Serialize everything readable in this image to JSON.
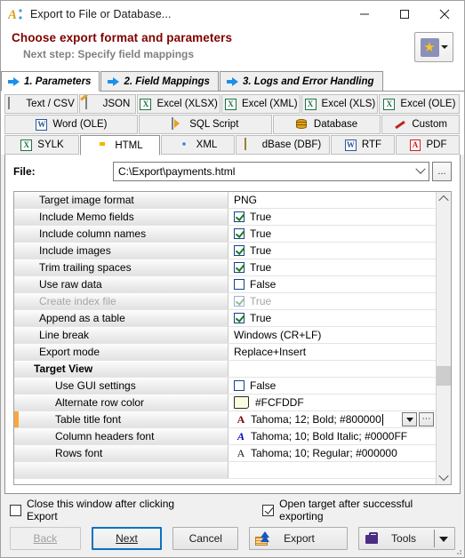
{
  "window": {
    "title": "Export to File or Database...",
    "app_icon": "export-wizard-icon",
    "minimize": "—",
    "maximize": "☐",
    "close": "✕"
  },
  "header": {
    "title": "Choose export format and parameters",
    "subtitle": "Next step: Specify field mappings",
    "favorites_icon": "star-icon"
  },
  "step_tabs": [
    {
      "label": "1. Parameters",
      "active": true
    },
    {
      "label": "2. Field Mappings",
      "active": false
    },
    {
      "label": "3. Logs and Error Handling",
      "active": false
    }
  ],
  "format_tabs": {
    "row1": [
      {
        "label": "Text / CSV",
        "icon": "text-file-icon",
        "selected": false
      },
      {
        "label": "JSON",
        "icon": "json-file-icon",
        "selected": false
      },
      {
        "label": "Excel (XLSX)",
        "icon": "excel-icon",
        "selected": false
      },
      {
        "label": "Excel (XML)",
        "icon": "excel-icon",
        "selected": false
      },
      {
        "label": "Excel (XLS)",
        "icon": "excel-icon",
        "selected": false
      },
      {
        "label": "Excel (OLE)",
        "icon": "excel-icon",
        "selected": false
      }
    ],
    "row2": [
      {
        "label": "Word (OLE)",
        "icon": "word-icon",
        "selected": false
      },
      {
        "label": "SQL Script",
        "icon": "sql-script-icon",
        "selected": false
      },
      {
        "label": "Database",
        "icon": "database-icon",
        "selected": false
      },
      {
        "label": "Custom",
        "icon": "pencil-icon",
        "selected": false
      }
    ],
    "row3": [
      {
        "label": "SYLK",
        "icon": "sylk-icon",
        "selected": false
      },
      {
        "label": "HTML",
        "icon": "html-icon",
        "selected": true
      },
      {
        "label": "XML",
        "icon": "chrome-icon",
        "selected": false
      },
      {
        "label": "dBase (DBF)",
        "icon": "dbase-grid-icon",
        "selected": false
      },
      {
        "label": "RTF",
        "icon": "word-icon",
        "selected": false
      },
      {
        "label": "PDF",
        "icon": "pdf-icon",
        "selected": false
      }
    ]
  },
  "file_field": {
    "label": "File:",
    "value": "C:\\Export\\payments.html",
    "browse_label": "...",
    "dropdown_icon": "chevron-down-icon"
  },
  "properties": [
    {
      "name": "Target image format",
      "type": "text",
      "value": "PNG",
      "level": 0
    },
    {
      "name": "Include Memo fields",
      "type": "bool",
      "value": "True",
      "checked": true,
      "level": 0
    },
    {
      "name": "Include column names",
      "type": "bool",
      "value": "True",
      "checked": true,
      "level": 0
    },
    {
      "name": "Include images",
      "type": "bool",
      "value": "True",
      "checked": true,
      "level": 0
    },
    {
      "name": "Trim trailing spaces",
      "type": "bool",
      "value": "True",
      "checked": true,
      "level": 0
    },
    {
      "name": "Use raw data",
      "type": "bool",
      "value": "False",
      "checked": false,
      "level": 0
    },
    {
      "name": "Create index file",
      "type": "bool",
      "value": "True",
      "checked": true,
      "level": 0,
      "disabled": true
    },
    {
      "name": "Append as a table",
      "type": "bool",
      "value": "True",
      "checked": true,
      "level": 0
    },
    {
      "name": "Line break",
      "type": "text",
      "value": "Windows (CR+LF)",
      "level": 0
    },
    {
      "name": "Export mode",
      "type": "text",
      "value": "Replace+Insert",
      "level": 0
    },
    {
      "name": "Target View",
      "type": "group",
      "value": "",
      "level": 0
    },
    {
      "name": "Use GUI settings",
      "type": "bool",
      "value": "False",
      "checked": false,
      "level": 1
    },
    {
      "name": "Alternate row color",
      "type": "color",
      "value": "#FCFDDF",
      "swatch": "#FCFDDF",
      "level": 1
    },
    {
      "name": "Table title font",
      "type": "font",
      "value": "Tahoma; 12; Bold; #800000",
      "glyph": "A",
      "glyph_color": "maroon",
      "level": 1,
      "editing": true
    },
    {
      "name": "Column headers font",
      "type": "font",
      "value": "Tahoma; 10; Bold Italic; #0000FF",
      "glyph": "A",
      "glyph_color": "blue",
      "level": 1
    },
    {
      "name": "Rows font",
      "type": "font",
      "value": "Tahoma; 10; Regular; #000000",
      "glyph": "A",
      "glyph_color": "black",
      "level": 1
    }
  ],
  "editor_buttons": {
    "dropdown_icon": "chevron-down-icon",
    "ellipsis_label": "⋯"
  },
  "scrollbar": {
    "up_icon": "chevron-up-icon",
    "down_icon": "chevron-down-icon"
  },
  "footer": {
    "close_window_checkbox": {
      "label": "Close this window after clicking Export",
      "checked": false
    },
    "open_target_checkbox": {
      "label": "Open target after successful exporting",
      "checked": true
    },
    "buttons": {
      "back": "Back",
      "next": "Next",
      "next_mnemonic": "N",
      "cancel": "Cancel",
      "export": "Export",
      "tools": "Tools"
    }
  },
  "colors": {
    "header_title": "#800000",
    "header_subtitle": "#808080",
    "accent_blue": "#0A72C4",
    "row_marker": "#F5A93C",
    "alt_row_color": "#FCFDDF",
    "title_font_color": "#800000",
    "headers_font_color": "#0000FF",
    "rows_font_color": "#000000"
  }
}
